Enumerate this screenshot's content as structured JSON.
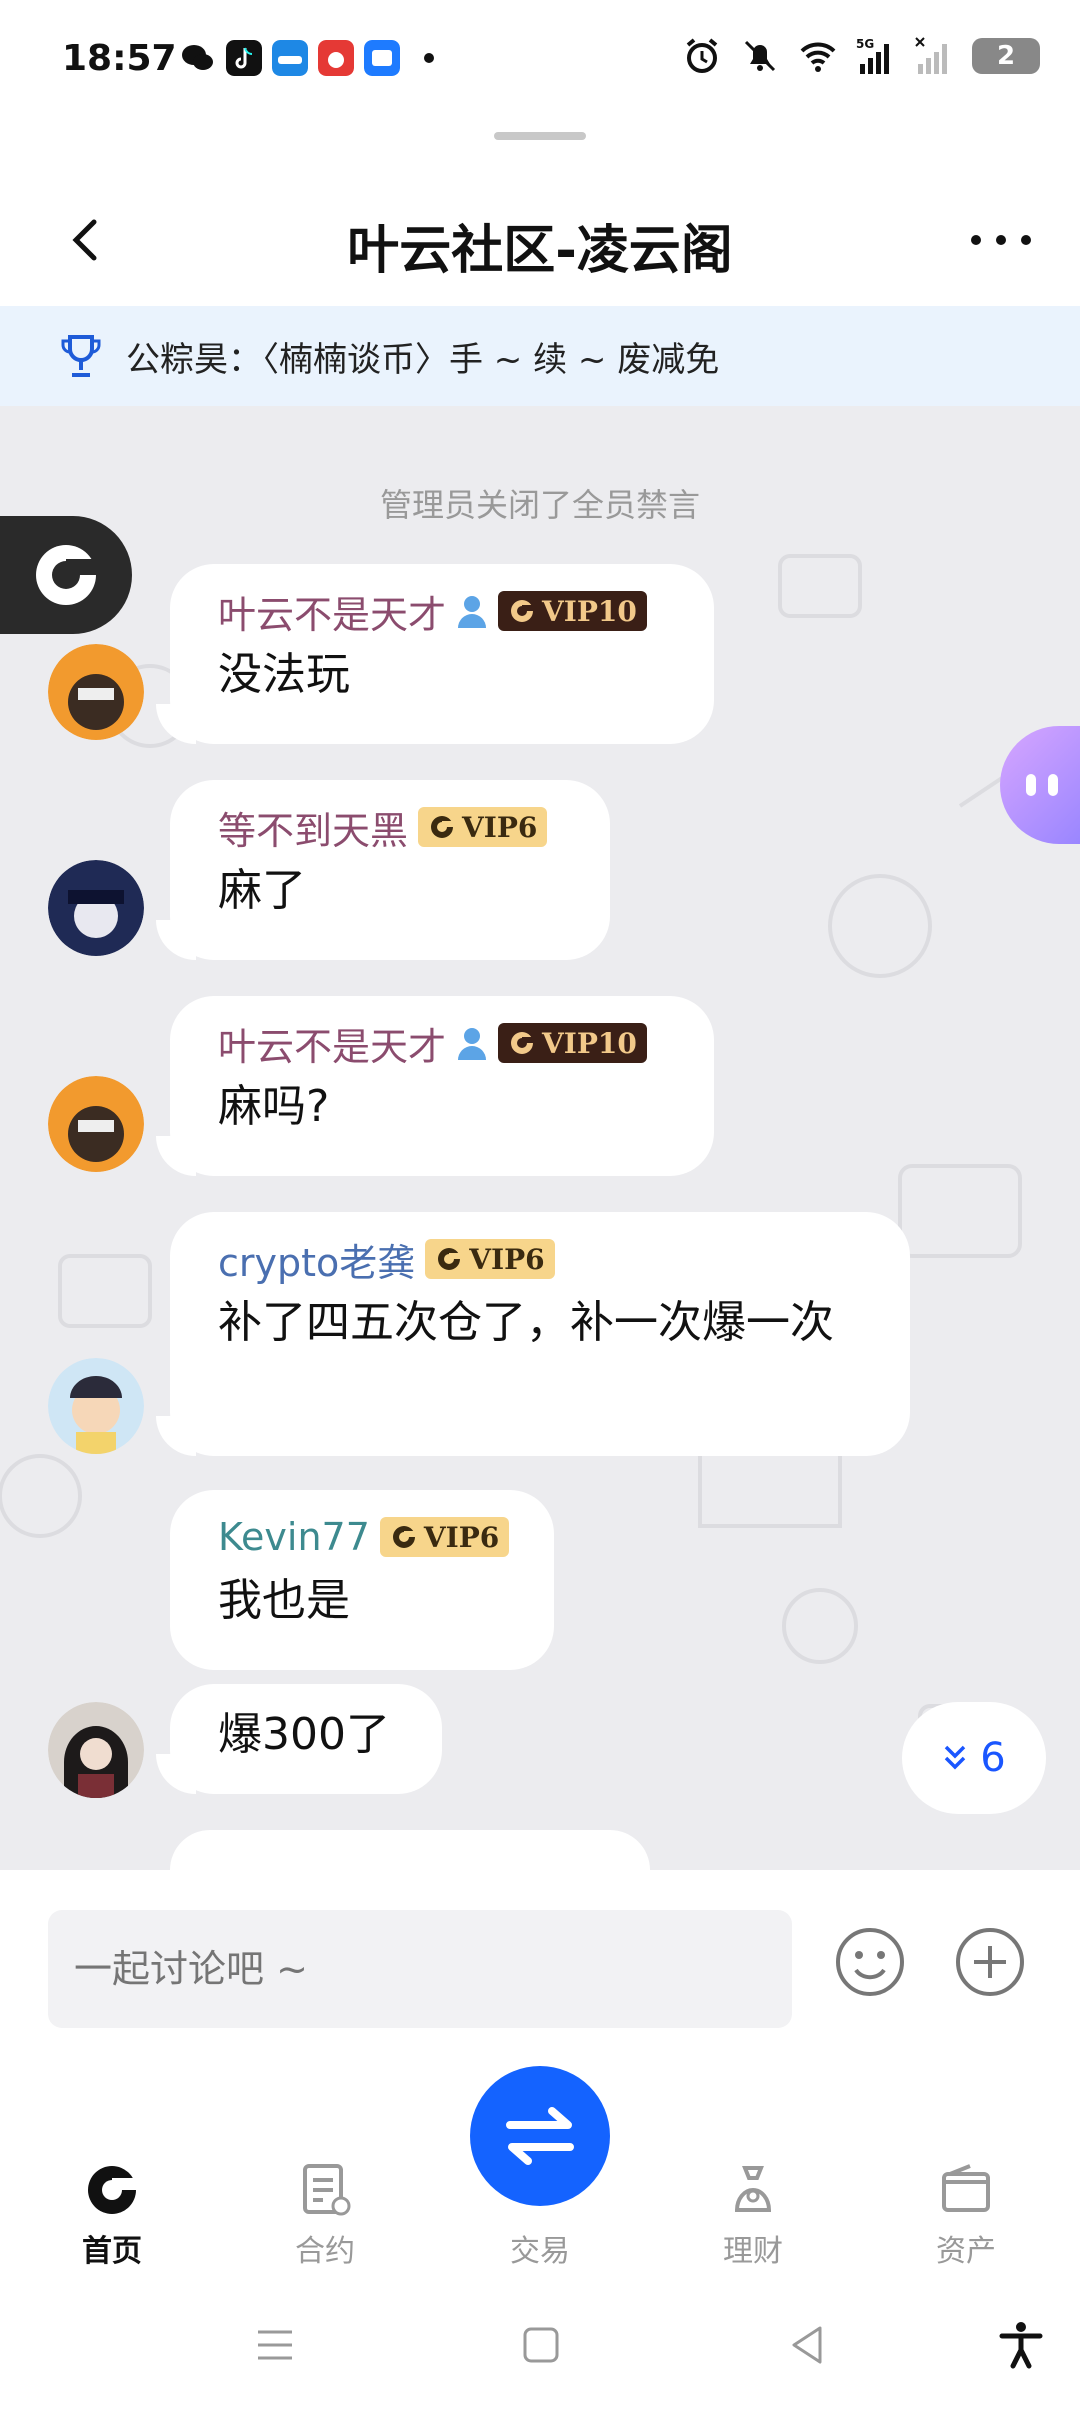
{
  "status_bar": {
    "time": "18:57",
    "battery": "2",
    "network": "5G"
  },
  "header": {
    "title": "叶云社区-凌云阁"
  },
  "pinned": {
    "text": "公粽昊：〈楠楠谈币〉手 ~ 续 ~ 废减免"
  },
  "chat": {
    "system_message": "管理员关闭了全员禁言",
    "messages": [
      {
        "sender": "叶云不是天才",
        "name_color": "#8b4c6e",
        "admin": true,
        "vip": "VIP10",
        "vip_style": "dark",
        "text": "没法玩"
      },
      {
        "sender": "等不到天黑",
        "name_color": "#8b4c6e",
        "admin": false,
        "vip": "VIP6",
        "vip_style": "gold",
        "text": "麻了"
      },
      {
        "sender": "叶云不是天才",
        "name_color": "#8b4c6e",
        "admin": true,
        "vip": "VIP10",
        "vip_style": "dark",
        "text": "麻吗?"
      },
      {
        "sender": "crypto老龚",
        "name_color": "#4a6fb0",
        "admin": false,
        "vip": "VIP6",
        "vip_style": "gold",
        "text": "补了四五次仓了，补一次爆一次"
      },
      {
        "sender": "Kevin77",
        "name_color": "#3d8a8f",
        "admin": false,
        "vip": "VIP6",
        "vip_style": "gold",
        "text": "我也是"
      },
      {
        "sender": "",
        "name_color": "#3d8a8f",
        "admin": false,
        "vip": "",
        "vip_style": "",
        "text": "爆300了"
      }
    ],
    "unread_count": "6"
  },
  "input": {
    "placeholder": "一起讨论吧 ~"
  },
  "nav": {
    "items": [
      {
        "label": "首页",
        "active": true
      },
      {
        "label": "合约",
        "active": false
      },
      {
        "label": "交易",
        "active": false
      },
      {
        "label": "理财",
        "active": false
      },
      {
        "label": "资产",
        "active": false
      }
    ]
  },
  "colors": {
    "accent": "#1463ff",
    "pinned_bg": "#eaf3fd",
    "chat_bg": "#ececef"
  }
}
